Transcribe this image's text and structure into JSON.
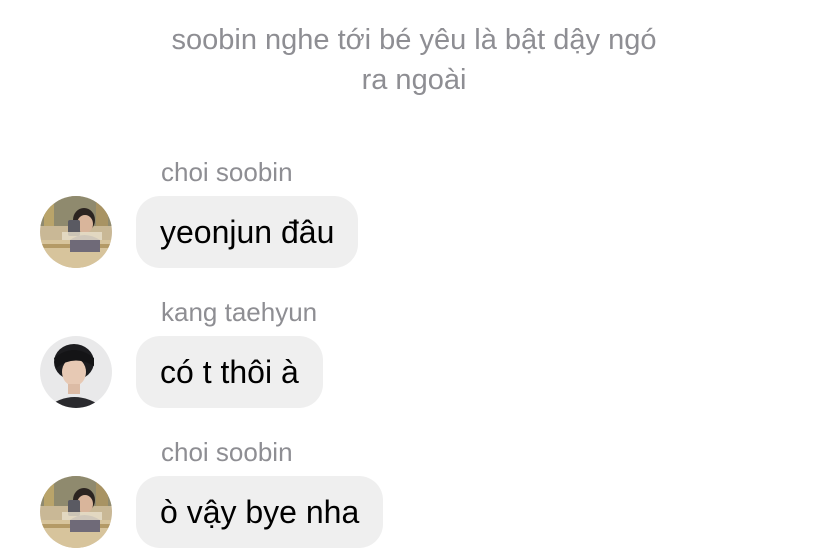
{
  "system_note": {
    "line1": "soobin nghe tới bé yêu là bật dậy ngó",
    "line2": "ra ngoài"
  },
  "messages": [
    {
      "sender": "choi soobin",
      "text": "yeonjun đâu",
      "avatar": "soobin-avatar"
    },
    {
      "sender": "kang taehyun",
      "text": "có t thôi à",
      "avatar": "taehyun-avatar"
    },
    {
      "sender": "choi soobin",
      "text": "ò vậy bye nha",
      "avatar": "soobin-avatar"
    }
  ],
  "colors": {
    "background": "#ffffff",
    "bubble": "#efefef",
    "meta_text": "#8e8e93",
    "message_text": "#000000"
  }
}
